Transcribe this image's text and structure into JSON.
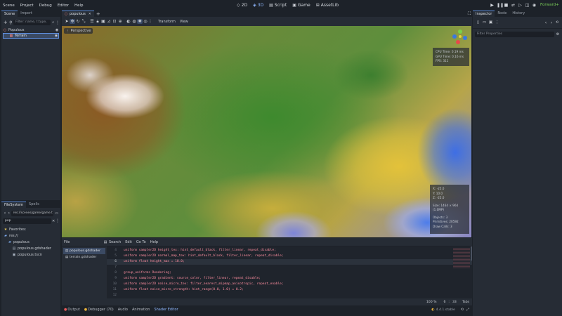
{
  "menubar": {
    "items": [
      "Scene",
      "Project",
      "Debug",
      "Editor",
      "Help"
    ],
    "workspaces": [
      {
        "label": "2D",
        "icon": "2d-icon"
      },
      {
        "label": "3D",
        "icon": "3d-icon",
        "active": true
      },
      {
        "label": "Script",
        "icon": "script-icon"
      },
      {
        "label": "Game",
        "icon": "game-icon"
      },
      {
        "label": "AssetLib",
        "icon": "assetlib-icon"
      }
    ],
    "renderer": "Forward+"
  },
  "scene_dock": {
    "tabs": [
      "Scene",
      "Import"
    ],
    "filter_placeholder": "Filter: name, t:type, ",
    "tree": [
      {
        "label": "Populous",
        "icon": "node3d-icon",
        "indent": 0
      },
      {
        "label": "Terrain",
        "icon": "mesh-icon",
        "indent": 1,
        "selected": true
      }
    ]
  },
  "filesystem_dock": {
    "tabs": [
      "FileSystem",
      "Spells"
    ],
    "path": "res://scenes/game/game.t",
    "search": "pop",
    "items": [
      {
        "label": "Favorites:",
        "icon": "star-icon",
        "indent": 0
      },
      {
        "label": "res://",
        "icon": "folder-icon",
        "indent": 0
      },
      {
        "label": "populous",
        "icon": "folder-icon",
        "indent": 1
      },
      {
        "label": "populous.gdshader",
        "icon": "shader-icon",
        "indent": 2
      },
      {
        "label": "populous.tscn",
        "icon": "scene-icon",
        "indent": 2
      }
    ]
  },
  "editor_tabs": {
    "active": "populous"
  },
  "toolbar3d": {
    "menus": [
      "Transform",
      "View"
    ]
  },
  "viewport": {
    "perspective_label": "Perspective",
    "perf": [
      "CPU Time: 0.19 ms",
      "GPU Time: 0.16 ms",
      "FPS: 311"
    ],
    "info": [
      "X: -25.0",
      "Y: 10.0",
      "Z: -25.0",
      "",
      "Size: 1464 × 964 (1.0MP)",
      "",
      "Objects: 3",
      "Primitives: 20592",
      "Draw Calls: 3"
    ],
    "gizmo_axes": [
      "Y",
      "X",
      "Z"
    ]
  },
  "shader_editor": {
    "menus": [
      "File",
      "Search",
      "Edit",
      "Go To",
      "Help"
    ],
    "files": [
      "populous.gdshader",
      "terrain.gdshader"
    ],
    "active_file": "populous.gdshader",
    "lines": [
      {
        "n": "4",
        "text": "uniform sampler2D height_tex: hint_default_black, filter_linear, repeat_disable;"
      },
      {
        "n": "5",
        "text": "uniform sampler2D normal_map_tex: hint_default_black, filter_linear, repeat_disable;"
      },
      {
        "n": "6",
        "text": "uniform float height_max = 10.0;"
      },
      {
        "n": "7",
        "text": ""
      },
      {
        "n": "8",
        "text": "group_uniforms Rendering;"
      },
      {
        "n": "9",
        "text": "uniform sampler2D gradient: source_color, filter_linear, repeat_disable;"
      },
      {
        "n": "10",
        "text": "uniform sampler2D noise_micro_tex: filter_nearest_mipmap_anisotropic, repeat_enable;"
      },
      {
        "n": "11",
        "text": "uniform float noise_micro_strength: hint_range(0.0, 1.0) = 0.2;"
      },
      {
        "n": "12",
        "text": ""
      }
    ],
    "status": {
      "zoom": "100 %",
      "line": "6",
      "col": "33",
      "indent": "Tabs"
    },
    "version": "4.4.1.stable"
  },
  "bottom_tabs": [
    "Output",
    "Debugger (70)",
    "Audio",
    "Animation",
    "Shader Editor"
  ],
  "inspector": {
    "tabs": [
      "Inspector",
      "Node",
      "History"
    ],
    "filter_placeholder": "Filter Properties"
  }
}
